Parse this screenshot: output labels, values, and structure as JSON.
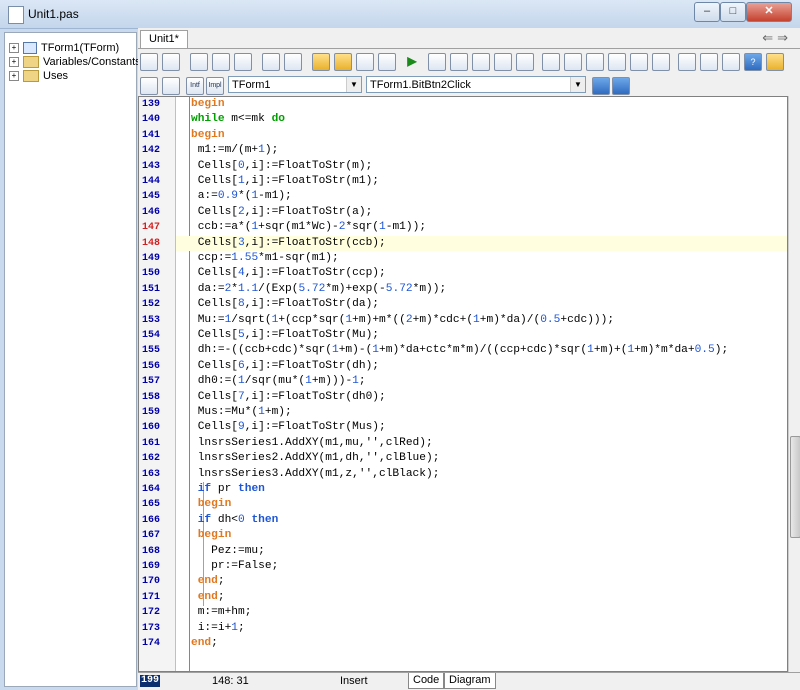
{
  "window": {
    "title": "Unit1.pas",
    "minimize": "–",
    "maximize": "□",
    "close": "✕"
  },
  "tree": {
    "items": [
      {
        "label": "TForm1(TForm)",
        "expander": "+"
      },
      {
        "label": "Variables/Constants",
        "expander": "+"
      },
      {
        "label": "Uses",
        "expander": "+"
      }
    ]
  },
  "tabs": {
    "active": "Unit1*"
  },
  "nav": {
    "back": "⇐",
    "forward": "⇒"
  },
  "toolbar2": {
    "intf_label": "Intf",
    "impl_label": "Impl",
    "class_combo": "TForm1",
    "method_combo": "TForm1.BitBtn2Click"
  },
  "editor": {
    "highlight_line": "148",
    "lines": [
      {
        "n": "139",
        "code": "begin"
      },
      {
        "n": "140",
        "code": "while m<=mk do"
      },
      {
        "n": "141",
        "code": "begin"
      },
      {
        "n": "142",
        "code": " m1:=m/(m+1);"
      },
      {
        "n": "143",
        "code": " Cells[0,i]:=FloatToStr(m);"
      },
      {
        "n": "144",
        "code": " Cells[1,i]:=FloatToStr(m1);"
      },
      {
        "n": "145",
        "code": " a:=0.9*(1-m1);"
      },
      {
        "n": "146",
        "code": " Cells[2,i]:=FloatToStr(a);"
      },
      {
        "n": "147",
        "code": " ccb:=a*(1+sqr(m1*Wc)-2*sqr(1-m1));"
      },
      {
        "n": "148",
        "code": " Cells[3,i]:=FloatToStr(ccb);"
      },
      {
        "n": "149",
        "code": " ccp:=1.55*m1-sqr(m1);"
      },
      {
        "n": "150",
        "code": " Cells[4,i]:=FloatToStr(ccp);"
      },
      {
        "n": "151",
        "code": " da:=2*1.1/(Exp(5.72*m)+exp(-5.72*m));"
      },
      {
        "n": "152",
        "code": " Cells[8,i]:=FloatToStr(da);"
      },
      {
        "n": "153",
        "code": " Mu:=1/sqrt(1+(ccp*sqr(1+m)+m*((2+m)*cdc+(1+m)*da)/(0.5+cdc)));"
      },
      {
        "n": "154",
        "code": " Cells[5,i]:=FloatToStr(Mu);"
      },
      {
        "n": "155",
        "code": " dh:=-((ccb+cdc)*sqr(1+m)-(1+m)*da+ctc*m*m)/((ccp+cdc)*sqr(1+m)+(1+m)*m*da+0.5);"
      },
      {
        "n": "156",
        "code": " Cells[6,i]:=FloatToStr(dh);"
      },
      {
        "n": "157",
        "code": " dh0:=(1/sqr(mu*(1+m)))-1;"
      },
      {
        "n": "158",
        "code": " Cells[7,i]:=FloatToStr(dh0);"
      },
      {
        "n": "159",
        "code": " Mus:=Mu*(1+m);"
      },
      {
        "n": "160",
        "code": " Cells[9,i]:=FloatToStr(Mus);"
      },
      {
        "n": "161",
        "code": " lnsrsSeries1.AddXY(m1,mu,'',clRed);"
      },
      {
        "n": "162",
        "code": " lnsrsSeries2.AddXY(m1,dh,'',clBlue);"
      },
      {
        "n": "163",
        "code": " lnsrsSeries3.AddXY(m1,z,'',clBlack);"
      },
      {
        "n": "164",
        "code": " if pr then"
      },
      {
        "n": "165",
        "code": " begin"
      },
      {
        "n": "166",
        "code": " if dh<0 then"
      },
      {
        "n": "167",
        "code": " begin"
      },
      {
        "n": "168",
        "code": "   Pez:=mu;"
      },
      {
        "n": "169",
        "code": "   pr:=False;"
      },
      {
        "n": "170",
        "code": " end;"
      },
      {
        "n": "171",
        "code": " end;"
      },
      {
        "n": "172",
        "code": " m:=m+hm;"
      },
      {
        "n": "173",
        "code": " i:=i+1;"
      },
      {
        "n": "174",
        "code": "end;"
      }
    ]
  },
  "status": {
    "current_line": "199",
    "position": "148: 31",
    "mode": "Insert",
    "tab_code": "Code",
    "tab_diagram": "Diagram"
  }
}
